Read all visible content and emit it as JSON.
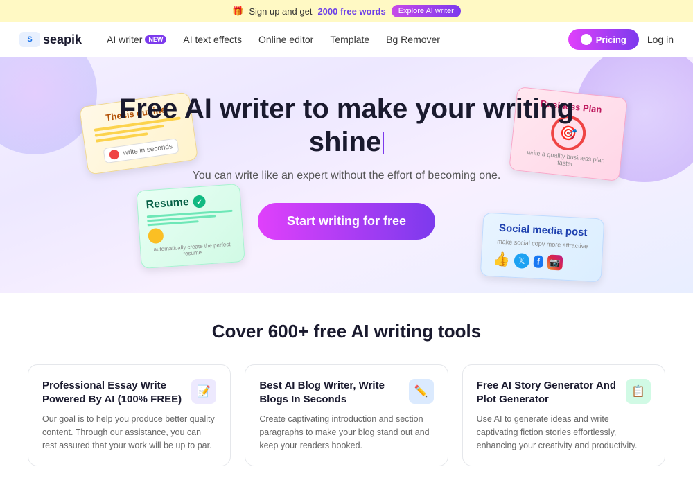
{
  "banner": {
    "gift_icon": "🎁",
    "text": "Sign up and get ",
    "highlight": "2000 free words",
    "explore_label": "Explore AI writer"
  },
  "navbar": {
    "logo_text": "seapik",
    "ai_writer_label": "AI writer",
    "ai_writer_badge": "NEW",
    "ai_text_effects_label": "AI text effects",
    "online_editor_label": "Online editor",
    "template_label": "Template",
    "bg_remover_label": "Bg Remover",
    "pricing_label": "Pricing",
    "login_label": "Log in"
  },
  "hero": {
    "title": "Free AI writer to make your writing shine",
    "subtitle": "You can write like an expert without the effort of becoming one.",
    "cta_label": "Start writing for free"
  },
  "cards": {
    "thesis": {
      "title": "Thesis outline",
      "tag": "write in seconds"
    },
    "business": {
      "title": "Business Plan",
      "subtitle": "write a quality business plan faster"
    },
    "resume": {
      "title": "Resume",
      "subtitle": "automatically create the perfect resume"
    },
    "social": {
      "title": "Social media post",
      "subtitle": "make social copy more attractive"
    }
  },
  "features": {
    "section_title": "Cover 600+ free AI writing tools",
    "cards": [
      {
        "title": "Professional Essay Write Powered By AI (100% FREE)",
        "description": "Our goal is to help you produce better quality content. Through our assistance, you can rest assured that your work will be up to par.",
        "icon": "📝",
        "icon_style": "fi-purple"
      },
      {
        "title": "Best AI Blog Writer, Write Blogs In Seconds",
        "description": "Create captivating introduction and section paragraphs to make your blog stand out and keep your readers hooked.",
        "icon": "✏️",
        "icon_style": "fi-blue"
      },
      {
        "title": "Free AI Story Generator And Plot Generator",
        "description": "Use AI to generate ideas and write captivating fiction stories effortlessly, enhancing your creativity and productivity.",
        "icon": "📋",
        "icon_style": "fi-green"
      }
    ]
  }
}
